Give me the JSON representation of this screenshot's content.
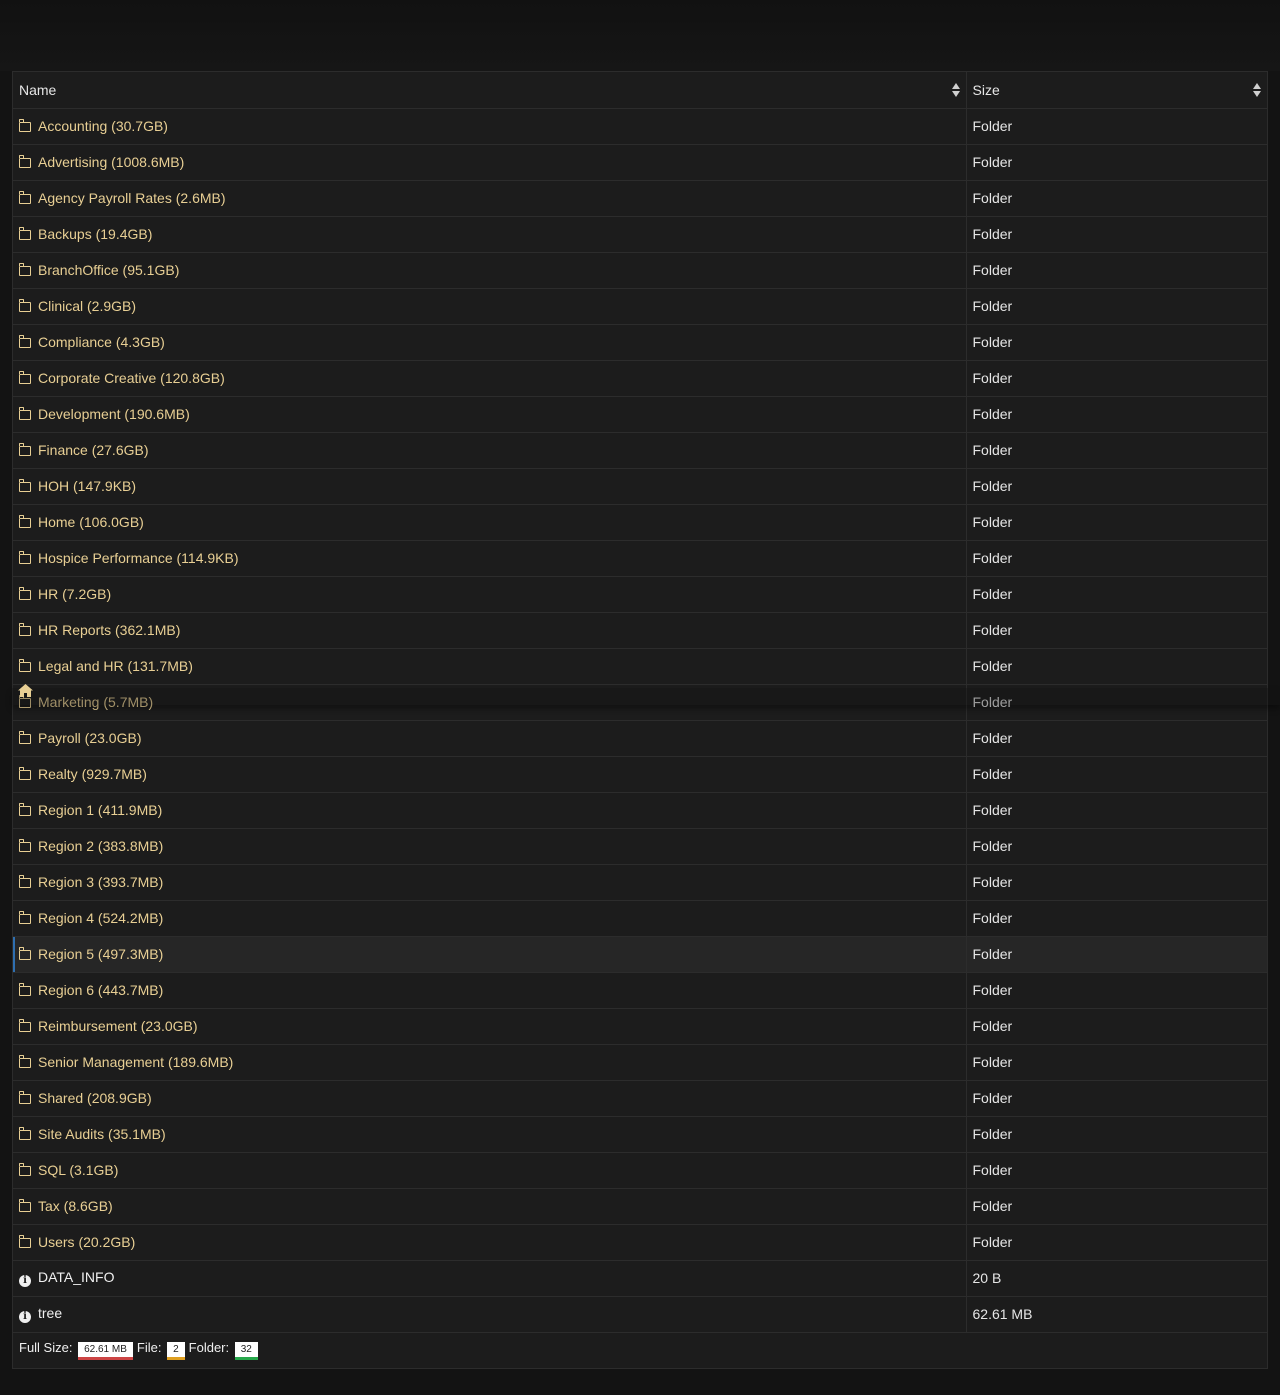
{
  "header": {
    "columns": [
      {
        "label": "Name"
      },
      {
        "label": "Size"
      }
    ]
  },
  "rows": [
    {
      "name": "Accounting (30.7GB)",
      "size": "Folder",
      "type": "folder"
    },
    {
      "name": "Advertising (1008.6MB)",
      "size": "Folder",
      "type": "folder"
    },
    {
      "name": "Agency Payroll Rates (2.6MB)",
      "size": "Folder",
      "type": "folder"
    },
    {
      "name": "Backups (19.4GB)",
      "size": "Folder",
      "type": "folder"
    },
    {
      "name": "BranchOffice (95.1GB)",
      "size": "Folder",
      "type": "folder"
    },
    {
      "name": "Clinical (2.9GB)",
      "size": "Folder",
      "type": "folder"
    },
    {
      "name": "Compliance (4.3GB)",
      "size": "Folder",
      "type": "folder"
    },
    {
      "name": "Corporate Creative (120.8GB)",
      "size": "Folder",
      "type": "folder"
    },
    {
      "name": "Development (190.6MB)",
      "size": "Folder",
      "type": "folder"
    },
    {
      "name": "Finance (27.6GB)",
      "size": "Folder",
      "type": "folder"
    },
    {
      "name": "HOH (147.9KB)",
      "size": "Folder",
      "type": "folder"
    },
    {
      "name": "Home (106.0GB)",
      "size": "Folder",
      "type": "folder"
    },
    {
      "name": "Hospice Performance (114.9KB)",
      "size": "Folder",
      "type": "folder"
    },
    {
      "name": "HR (7.2GB)",
      "size": "Folder",
      "type": "folder"
    },
    {
      "name": "HR Reports (362.1MB)",
      "size": "Folder",
      "type": "folder"
    },
    {
      "name": "Legal and HR (131.7MB)",
      "size": "Folder",
      "type": "folder"
    },
    {
      "name": "Marketing (5.7MB)",
      "size": "Folder",
      "type": "folder"
    },
    {
      "name": "Payroll (23.0GB)",
      "size": "Folder",
      "type": "folder"
    },
    {
      "name": "Realty (929.7MB)",
      "size": "Folder",
      "type": "folder"
    },
    {
      "name": "Region 1 (411.9MB)",
      "size": "Folder",
      "type": "folder"
    },
    {
      "name": "Region 2 (383.8MB)",
      "size": "Folder",
      "type": "folder"
    },
    {
      "name": "Region 3 (393.7MB)",
      "size": "Folder",
      "type": "folder"
    },
    {
      "name": "Region 4 (524.2MB)",
      "size": "Folder",
      "type": "folder"
    },
    {
      "name": "Region 5 (497.3MB)",
      "size": "Folder",
      "type": "folder",
      "selected": true
    },
    {
      "name": "Region 6 (443.7MB)",
      "size": "Folder",
      "type": "folder"
    },
    {
      "name": "Reimbursement (23.0GB)",
      "size": "Folder",
      "type": "folder"
    },
    {
      "name": "Senior Management (189.6MB)",
      "size": "Folder",
      "type": "folder"
    },
    {
      "name": "Shared (208.9GB)",
      "size": "Folder",
      "type": "folder"
    },
    {
      "name": "Site Audits (35.1MB)",
      "size": "Folder",
      "type": "folder"
    },
    {
      "name": "SQL (3.1GB)",
      "size": "Folder",
      "type": "folder"
    },
    {
      "name": "Tax (8.6GB)",
      "size": "Folder",
      "type": "folder"
    },
    {
      "name": "Users (20.2GB)",
      "size": "Folder",
      "type": "folder"
    },
    {
      "name": "DATA_INFO",
      "size": "20 B",
      "type": "file"
    },
    {
      "name": "tree",
      "size": "62.61 MB",
      "type": "file"
    }
  ],
  "footer": {
    "full_size_label": "Full Size:",
    "full_size_value": "62.61 MB",
    "file_label": "File:",
    "file_count": "2",
    "folder_label": "Folder:",
    "folder_count": "32"
  },
  "colors": {
    "folder_text": "#e8cf94",
    "selection_accent": "#2f6fb0",
    "full_size_underline": "#c44444",
    "file_underline": "#e0a020",
    "folder_underline": "#27a84b"
  },
  "icons": {
    "folder": "folder-outline-icon",
    "file": "info-circle-icon",
    "home": "home-icon",
    "sort": "sort-icon"
  }
}
